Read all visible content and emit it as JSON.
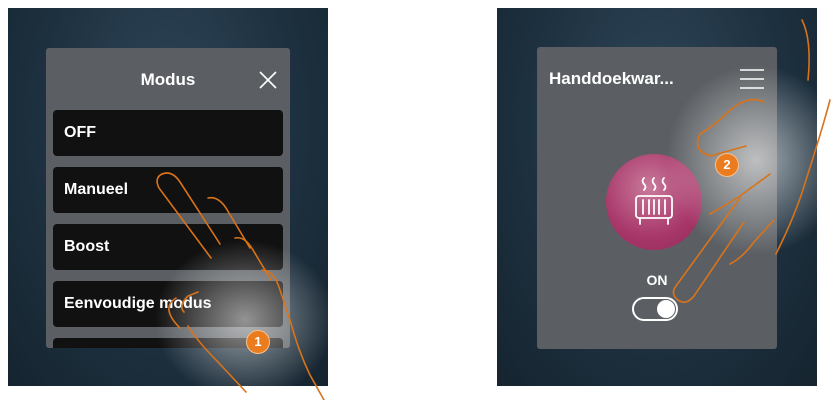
{
  "left_panel": {
    "title": "Modus",
    "modes": [
      {
        "label": "OFF"
      },
      {
        "label": "Manueel"
      },
      {
        "label": "Boost"
      },
      {
        "label": "Eenvoudige modus"
      }
    ],
    "step_number": "1"
  },
  "right_panel": {
    "device_name": "Handdoekwar...",
    "state_label": "ON",
    "toggle_on": true,
    "accent_color": "#a8376a",
    "step_number": "2"
  },
  "colors": {
    "panel_bg": "#5b5f63",
    "screen_bg": "#1e3140",
    "mode_item_bg": "#111111",
    "step_badge": "#ea7c1f"
  },
  "icons": {
    "close": "close-icon",
    "menu": "hamburger-menu-icon",
    "device": "towel-heater-icon",
    "pointer": "pointing-hand-icon"
  }
}
